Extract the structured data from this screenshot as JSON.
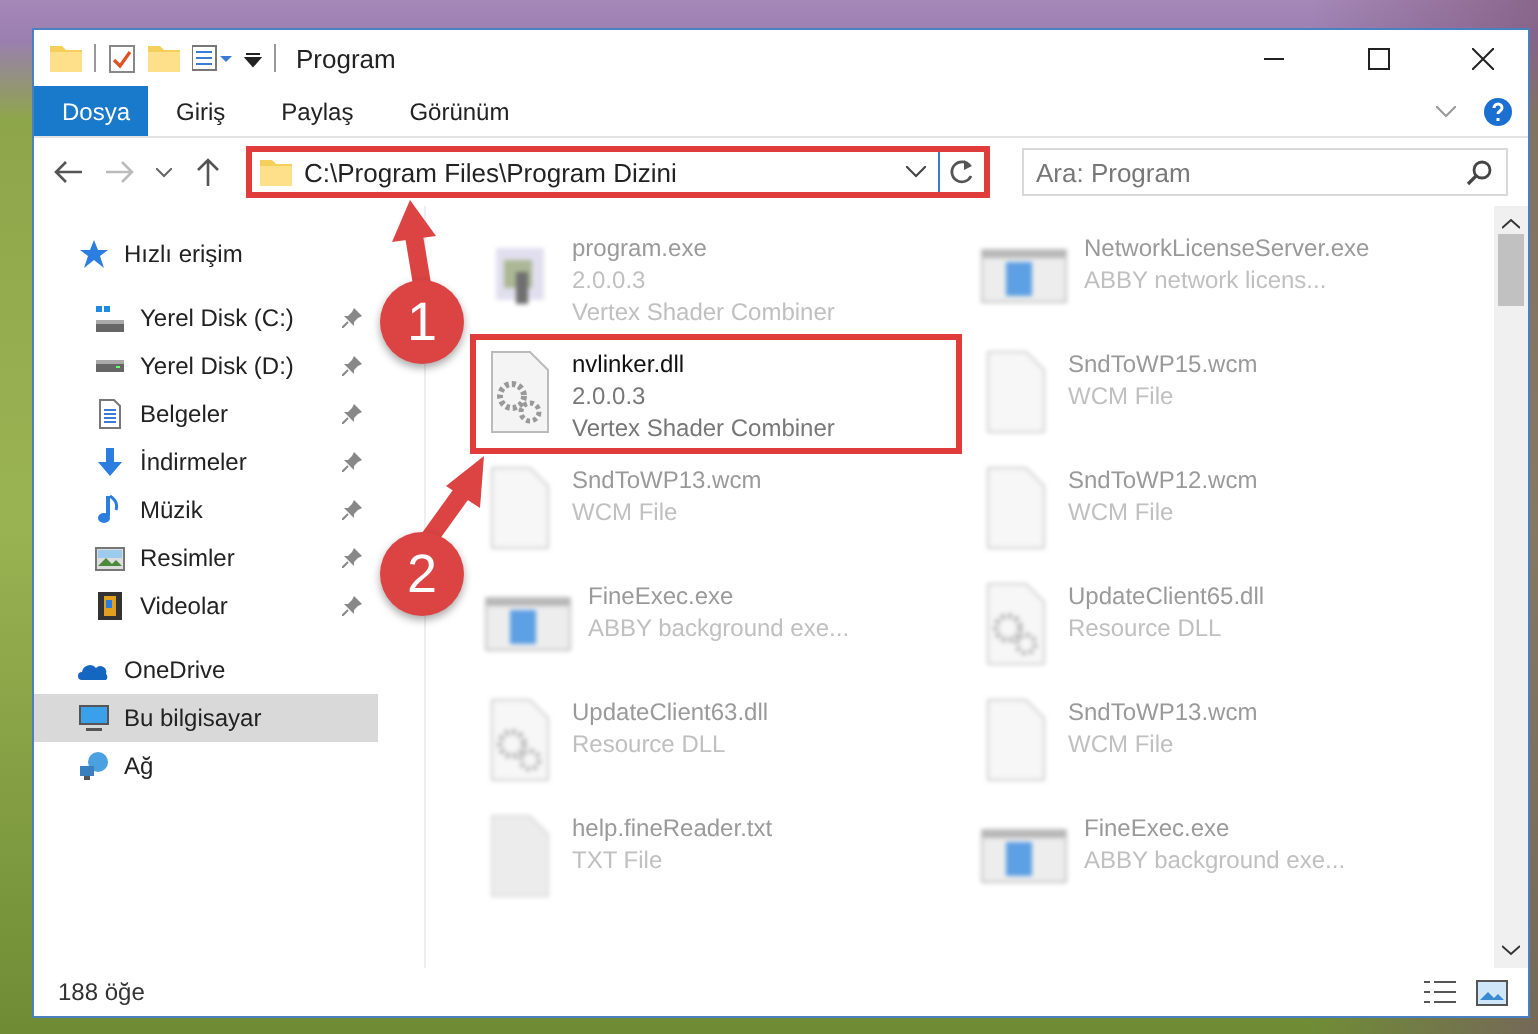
{
  "window": {
    "title": "Program"
  },
  "ribbon_tabs": [
    {
      "label": "Dosya",
      "kind": "file"
    },
    {
      "label": "Giriş",
      "kind": "tab"
    },
    {
      "label": "Paylaş",
      "kind": "tab"
    },
    {
      "label": "Görünüm",
      "kind": "tab"
    }
  ],
  "address": {
    "path": "C:\\Program Files\\Program Dizini",
    "highlighted": true
  },
  "search": {
    "placeholder": "Ara: Program"
  },
  "navigation": [
    {
      "label": "Hızlı erişim",
      "kind": "star",
      "selected": false,
      "children": [
        {
          "label": "Yerel Disk (C:)",
          "kind": "system_drive",
          "pinned": true,
          "selected": false
        },
        {
          "label": "Yerel Disk (D:)",
          "kind": "drive",
          "pinned": true,
          "selected": false
        },
        {
          "label": "Belgeler",
          "kind": "document",
          "pinned": true,
          "selected": false
        },
        {
          "label": "İndirmeler",
          "kind": "download",
          "pinned": true,
          "selected": false
        },
        {
          "label": "Müzik",
          "kind": "music",
          "pinned": true,
          "selected": false
        },
        {
          "label": "Resimler",
          "kind": "pictures",
          "pinned": true,
          "selected": false
        },
        {
          "label": "Videolar",
          "kind": "video",
          "pinned": true,
          "selected": false
        }
      ]
    },
    {
      "label": "OneDrive",
      "kind": "cloud",
      "selected": false
    },
    {
      "label": "Bu bilgisayar",
      "kind": "computer",
      "selected": true
    },
    {
      "label": "Ağ",
      "kind": "network",
      "selected": false
    }
  ],
  "files": [
    {
      "name": "program.exe",
      "details": [
        "2.0.0.3",
        "Vertex Shader Combiner"
      ],
      "kind": "installer",
      "blurred": true,
      "highlighted": false
    },
    {
      "name": "NetworkLicenseServer.exe",
      "details": [
        "ABBY network licens..."
      ],
      "kind": "app",
      "blurred": true,
      "highlighted": false
    },
    {
      "name": "nvlinker.dll",
      "details": [
        "2.0.0.3",
        "Vertex Shader Combiner"
      ],
      "kind": "library",
      "blurred": false,
      "highlighted": true
    },
    {
      "name": "SndToWP15.wcm",
      "details": [
        "WCM File"
      ],
      "kind": "blank",
      "blurred": true,
      "highlighted": false
    },
    {
      "name": "SndToWP13.wcm",
      "details": [
        "WCM File"
      ],
      "kind": "blank",
      "blurred": true,
      "highlighted": false
    },
    {
      "name": "SndToWP12.wcm",
      "details": [
        "WCM File"
      ],
      "kind": "blank",
      "blurred": true,
      "highlighted": false
    },
    {
      "name": "FineExec.exe",
      "details": [
        "ABBY background exe..."
      ],
      "kind": "app",
      "blurred": true,
      "highlighted": false
    },
    {
      "name": "UpdateClient65.dll",
      "details": [
        "Resource DLL"
      ],
      "kind": "library",
      "blurred": true,
      "highlighted": false
    },
    {
      "name": "UpdateClient63.dll",
      "details": [
        "Resource DLL"
      ],
      "kind": "library",
      "blurred": true,
      "highlighted": false
    },
    {
      "name": "SndToWP13.wcm",
      "details": [
        "WCM File"
      ],
      "kind": "blank",
      "blurred": true,
      "highlighted": false
    },
    {
      "name": "help.fineReader.txt",
      "details": [
        "TXT File"
      ],
      "kind": "text",
      "blurred": true,
      "highlighted": false
    },
    {
      "name": "FineExec.exe",
      "details": [
        "ABBY background exe..."
      ],
      "kind": "app",
      "blurred": true,
      "highlighted": false
    }
  ],
  "status_bar": {
    "count": "188 öğe"
  },
  "annotations": [
    {
      "number": "1"
    },
    {
      "number": "2"
    }
  ]
}
